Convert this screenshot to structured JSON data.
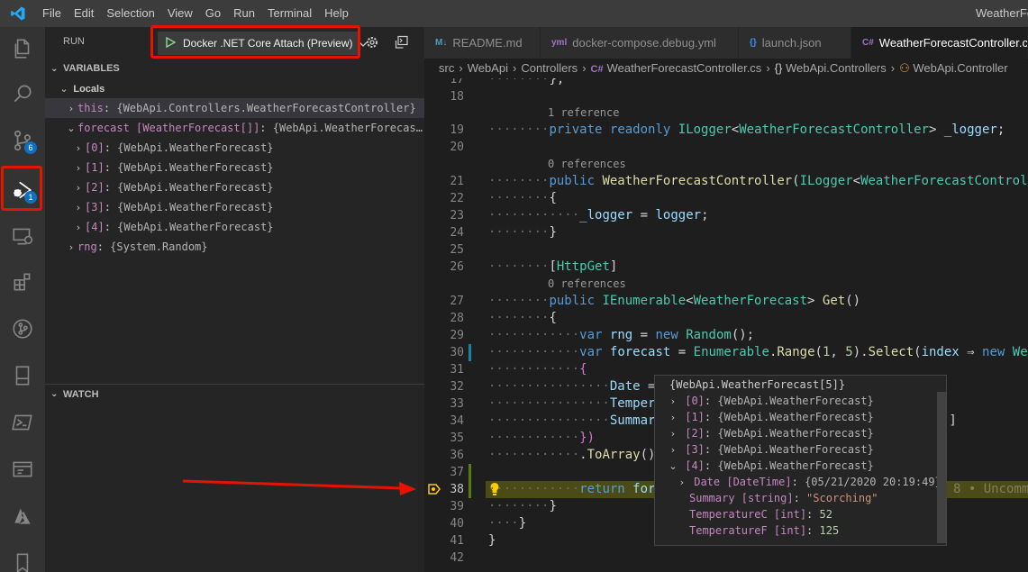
{
  "titlebar": {
    "menu": [
      "File",
      "Edit",
      "Selection",
      "View",
      "Go",
      "Run",
      "Terminal",
      "Help"
    ],
    "window_title": "WeatherFo"
  },
  "activitybar": {
    "scm_badge": "6",
    "debug_badge": "1"
  },
  "sidebar": {
    "run_label": "RUN",
    "config_name": "Docker .NET Core Attach (Preview)",
    "variables_header": "VARIABLES",
    "locals_header": "Locals",
    "variables": [
      {
        "name": "this",
        "value": "{WebApi.Controllers.WeatherForecastController}"
      },
      {
        "name": "forecast [WeatherForecast[]]",
        "value": "{WebApi.WeatherForecas…"
      },
      {
        "name": "[0]",
        "value": "{WebApi.WeatherForecast}"
      },
      {
        "name": "[1]",
        "value": "{WebApi.WeatherForecast}"
      },
      {
        "name": "[2]",
        "value": "{WebApi.WeatherForecast}"
      },
      {
        "name": "[3]",
        "value": "{WebApi.WeatherForecast}"
      },
      {
        "name": "[4]",
        "value": "{WebApi.WeatherForecast}"
      },
      {
        "name": "rng",
        "value": "{System.Random}"
      }
    ],
    "watch_header": "WATCH"
  },
  "tabs": [
    {
      "label": "README.md",
      "icon": "M↓",
      "active": false
    },
    {
      "label": "docker-compose.debug.yml",
      "icon": "yml",
      "active": false
    },
    {
      "label": "launch.json",
      "icon": "{}",
      "active": false
    },
    {
      "label": "WeatherForecastController.c",
      "icon": "C#",
      "active": true
    }
  ],
  "breadcrumb": {
    "items": [
      "src",
      "WebApi",
      "Controllers",
      "WeatherForecastController.cs",
      "WebApi.Controllers",
      "WebApi.Controller"
    ]
  },
  "code": {
    "line_numbers": [
      "17",
      "18",
      "19",
      "20",
      "21",
      "22",
      "23",
      "24",
      "25",
      "26",
      "27",
      "28",
      "29",
      "30",
      "31",
      "32",
      "33",
      "34",
      "35",
      "36",
      "37",
      "38",
      "39",
      "40",
      "41",
      "42"
    ],
    "codelens_1ref": "1 reference",
    "codelens_0ref_a": "0 references",
    "codelens_0ref_b": "0 references",
    "inline_blame": "8 • Uncomm"
  },
  "hover": {
    "title": "{WebApi.WeatherForecast[5]}",
    "items": [
      {
        "name": "[0]",
        "value": "{WebApi.WeatherForecast}"
      },
      {
        "name": "[1]",
        "value": "{WebApi.WeatherForecast}"
      },
      {
        "name": "[2]",
        "value": "{WebApi.WeatherForecast}"
      },
      {
        "name": "[3]",
        "value": "{WebApi.WeatherForecast}"
      },
      {
        "name": "[4]",
        "value": "{WebApi.WeatherForecast}"
      }
    ],
    "fields": [
      {
        "name": "Date [DateTime]",
        "value": "{05/21/2020 20:19:49}"
      },
      {
        "name": "Summary [string]",
        "value": "\"Scorching\""
      },
      {
        "name": "TemperatureC [int]",
        "value": "52"
      },
      {
        "name": "TemperatureF [int]",
        "value": "125"
      }
    ]
  },
  "colors": {
    "annotation_red": "#e51400",
    "accent_blue": "#0e70c0"
  }
}
